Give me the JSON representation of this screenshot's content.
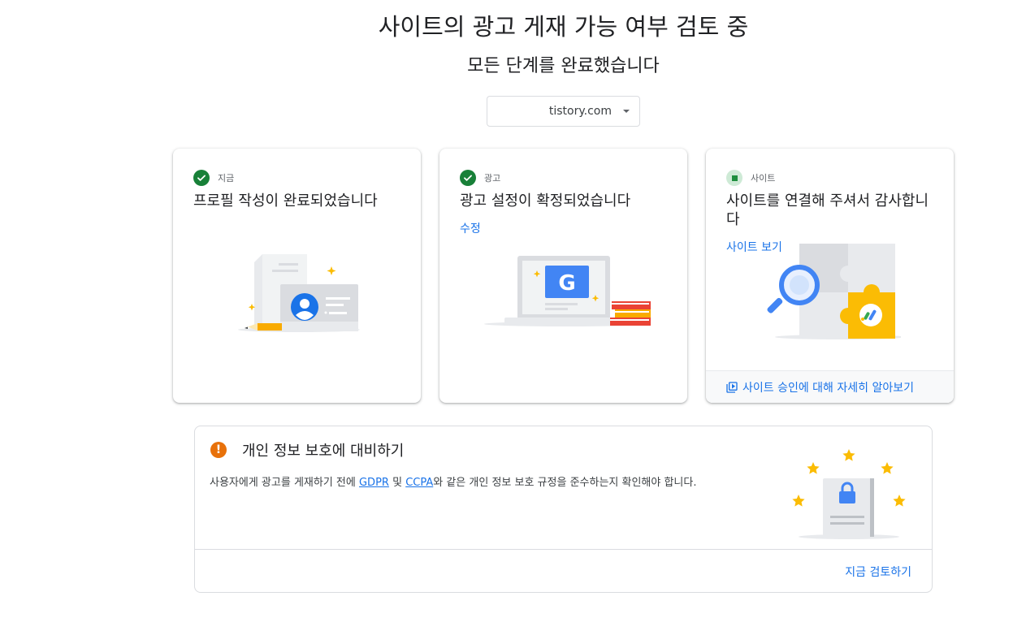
{
  "header": {
    "title": "사이트의 광고 게재 가능 여부 검토 중",
    "subtitle": "모든 단계를 완료했습니다"
  },
  "site_selector": {
    "value": "tistory.com",
    "icon": "caret-down-icon"
  },
  "cards": [
    {
      "status_label": "지금",
      "status_icon": "check-circle-icon",
      "heading": "프로필 작성이 완료되었습니다",
      "illustration": "profile-document-illustration"
    },
    {
      "status_label": "광고",
      "status_icon": "check-circle-icon",
      "heading": "광고 설정이 확정되었습니다",
      "link": "수정",
      "illustration": "laptop-google-illustration"
    },
    {
      "status_label": "사이트",
      "status_icon": "pending-square-icon",
      "heading": "사이트를 연결해 주셔서 감사합니다",
      "link": "사이트 보기",
      "footer_link": "사이트 승인에 대해 자세히 알아보기",
      "illustration": "puzzle-magnifier-illustration"
    }
  ],
  "privacy": {
    "title": "개인 정보 보호에 대비하기",
    "body_before": "사용자에게 광고를 게재하기 전에 ",
    "gdpr": "GDPR",
    "and": " 및 ",
    "ccpa": "CCPA",
    "body_after": "와 같은 개인 정보 보호 규정을 준수하는지 확인해야 합니다.",
    "action": "지금 검토하기",
    "illustration": "lock-document-stars-illustration"
  },
  "colors": {
    "success": "#188038",
    "link": "#1a73e8",
    "warning": "#e8710a",
    "google_blue": "#4285f4",
    "google_yellow": "#fbbc04",
    "google_red": "#ea4335"
  }
}
